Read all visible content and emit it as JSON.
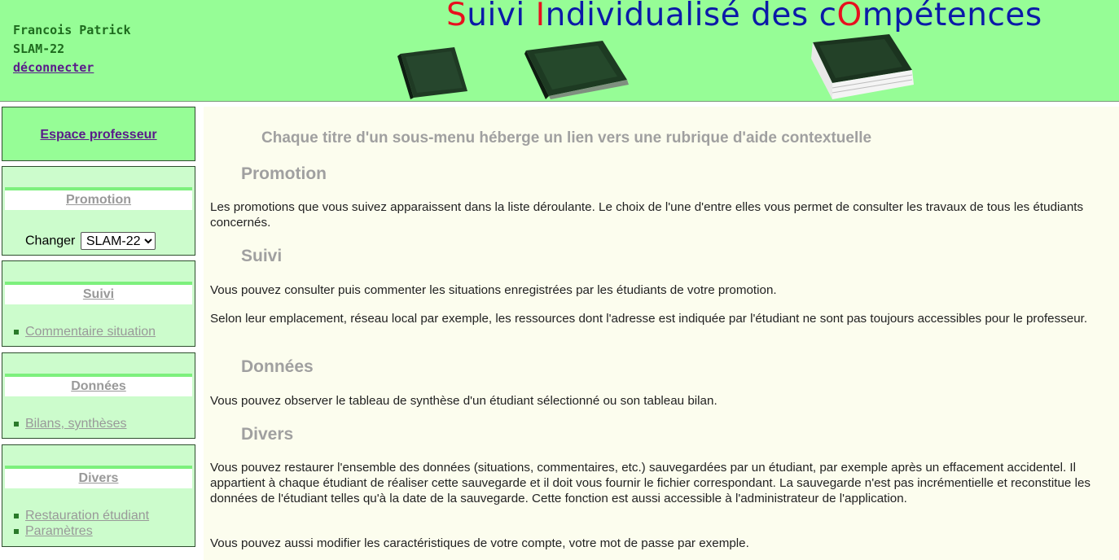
{
  "header": {
    "user_name": "Francois Patrick",
    "promotion": "SLAM-22",
    "logout_label": "déconnecter",
    "title_parts": [
      {
        "text": "S",
        "color": "red"
      },
      {
        "text": "uivi ",
        "color": "blue"
      },
      {
        "text": "I",
        "color": "red"
      },
      {
        "text": "ndividualisé des c",
        "color": "blue"
      },
      {
        "text": "O",
        "color": "red"
      },
      {
        "text": "mpétences",
        "color": "blue"
      }
    ],
    "colors": {
      "background": "#96fd96",
      "title_blue": "#0b1aa8",
      "title_red": "#e8101e"
    },
    "decor_icons": [
      "closed-book-icon",
      "closed-book-icon",
      "open-book-icon"
    ]
  },
  "sidebar": {
    "espace_label": "Espace professeur",
    "promotion": {
      "title": "Promotion",
      "changer_label": "Changer",
      "selected": "SLAM-22"
    },
    "suivi": {
      "title": "Suivi",
      "items": [
        "Commentaire situation"
      ]
    },
    "donnees": {
      "title": "Données",
      "items": [
        "Bilans, synthèses"
      ]
    },
    "divers": {
      "title": "Divers",
      "items": [
        "Restauration étudiant",
        "Paramètres"
      ]
    }
  },
  "main": {
    "intro": "Chaque titre d'un sous-menu héberge un lien vers une rubrique d'aide contextuelle",
    "sections": [
      {
        "title": "Promotion",
        "paragraphs": [
          "Les promotions que vous suivez apparaissent dans la liste déroulante. Le choix de l'une d'entre elles vous permet de consulter les travaux de tous les étudiants concernés."
        ]
      },
      {
        "title": "Suivi",
        "paragraphs": [
          "Vous pouvez consulter puis commenter les situations enregistrées par les étudiants de votre promotion.",
          "Selon leur emplacement, réseau local par exemple, les ressources dont l'adresse est indiquée par l'étudiant ne sont pas toujours accessibles pour le professeur."
        ]
      },
      {
        "title": "Données",
        "paragraphs": [
          "Vous pouvez observer le tableau de synthèse d'un étudiant sélectionné ou son tableau bilan."
        ]
      },
      {
        "title": "Divers",
        "paragraphs": [
          "Vous pouvez restaurer l'ensemble des données (situations, commentaires, etc.) sauvegardées par un étudiant, par exemple après un effacement accidentel. Il appartient à chaque étudiant de réaliser cette sauvegarde et il doit vous fournir le fichier correspondant. La sauvegarde n'est pas incrémentielle et reconstitue les données de l'étudiant telles qu'à la date de la sauvegarde. Cette fonction est aussi accessible à l'administrateur de l'application.",
          "Vous pouvez aussi modifier les caractéristiques de votre compte, votre mot de passe par exemple."
        ]
      }
    ]
  }
}
